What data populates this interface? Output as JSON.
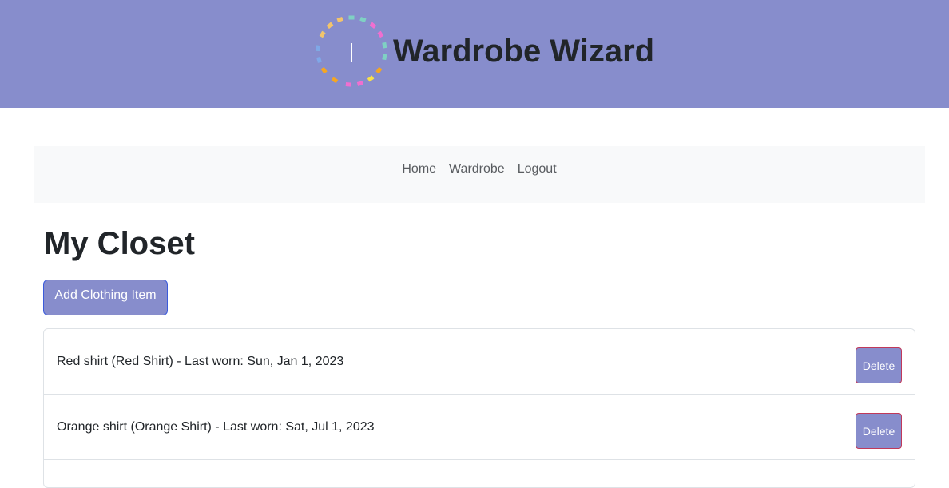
{
  "header": {
    "title": "Wardrobe Wizard",
    "logo_icon": "spinner-dots-icon",
    "background_color": "#878dcc"
  },
  "nav": {
    "items": [
      {
        "label": "Home"
      },
      {
        "label": "Wardrobe"
      },
      {
        "label": "Logout"
      }
    ]
  },
  "main": {
    "title": "My Closet",
    "add_button_label": "Add Clothing Item",
    "items": [
      {
        "text": "Red shirt (Red Shirt) - Last worn: Sun, Jan 1, 2023",
        "delete_label": "Delete"
      },
      {
        "text": "Orange shirt (Orange Shirt) - Last worn: Sat, Jul 1, 2023",
        "delete_label": "Delete"
      }
    ]
  },
  "colors": {
    "accent": "#878dcc",
    "add_button_border": "#3b5bdb",
    "delete_button_border": "#c0395a",
    "navbar_bg": "#f8f9fa"
  }
}
